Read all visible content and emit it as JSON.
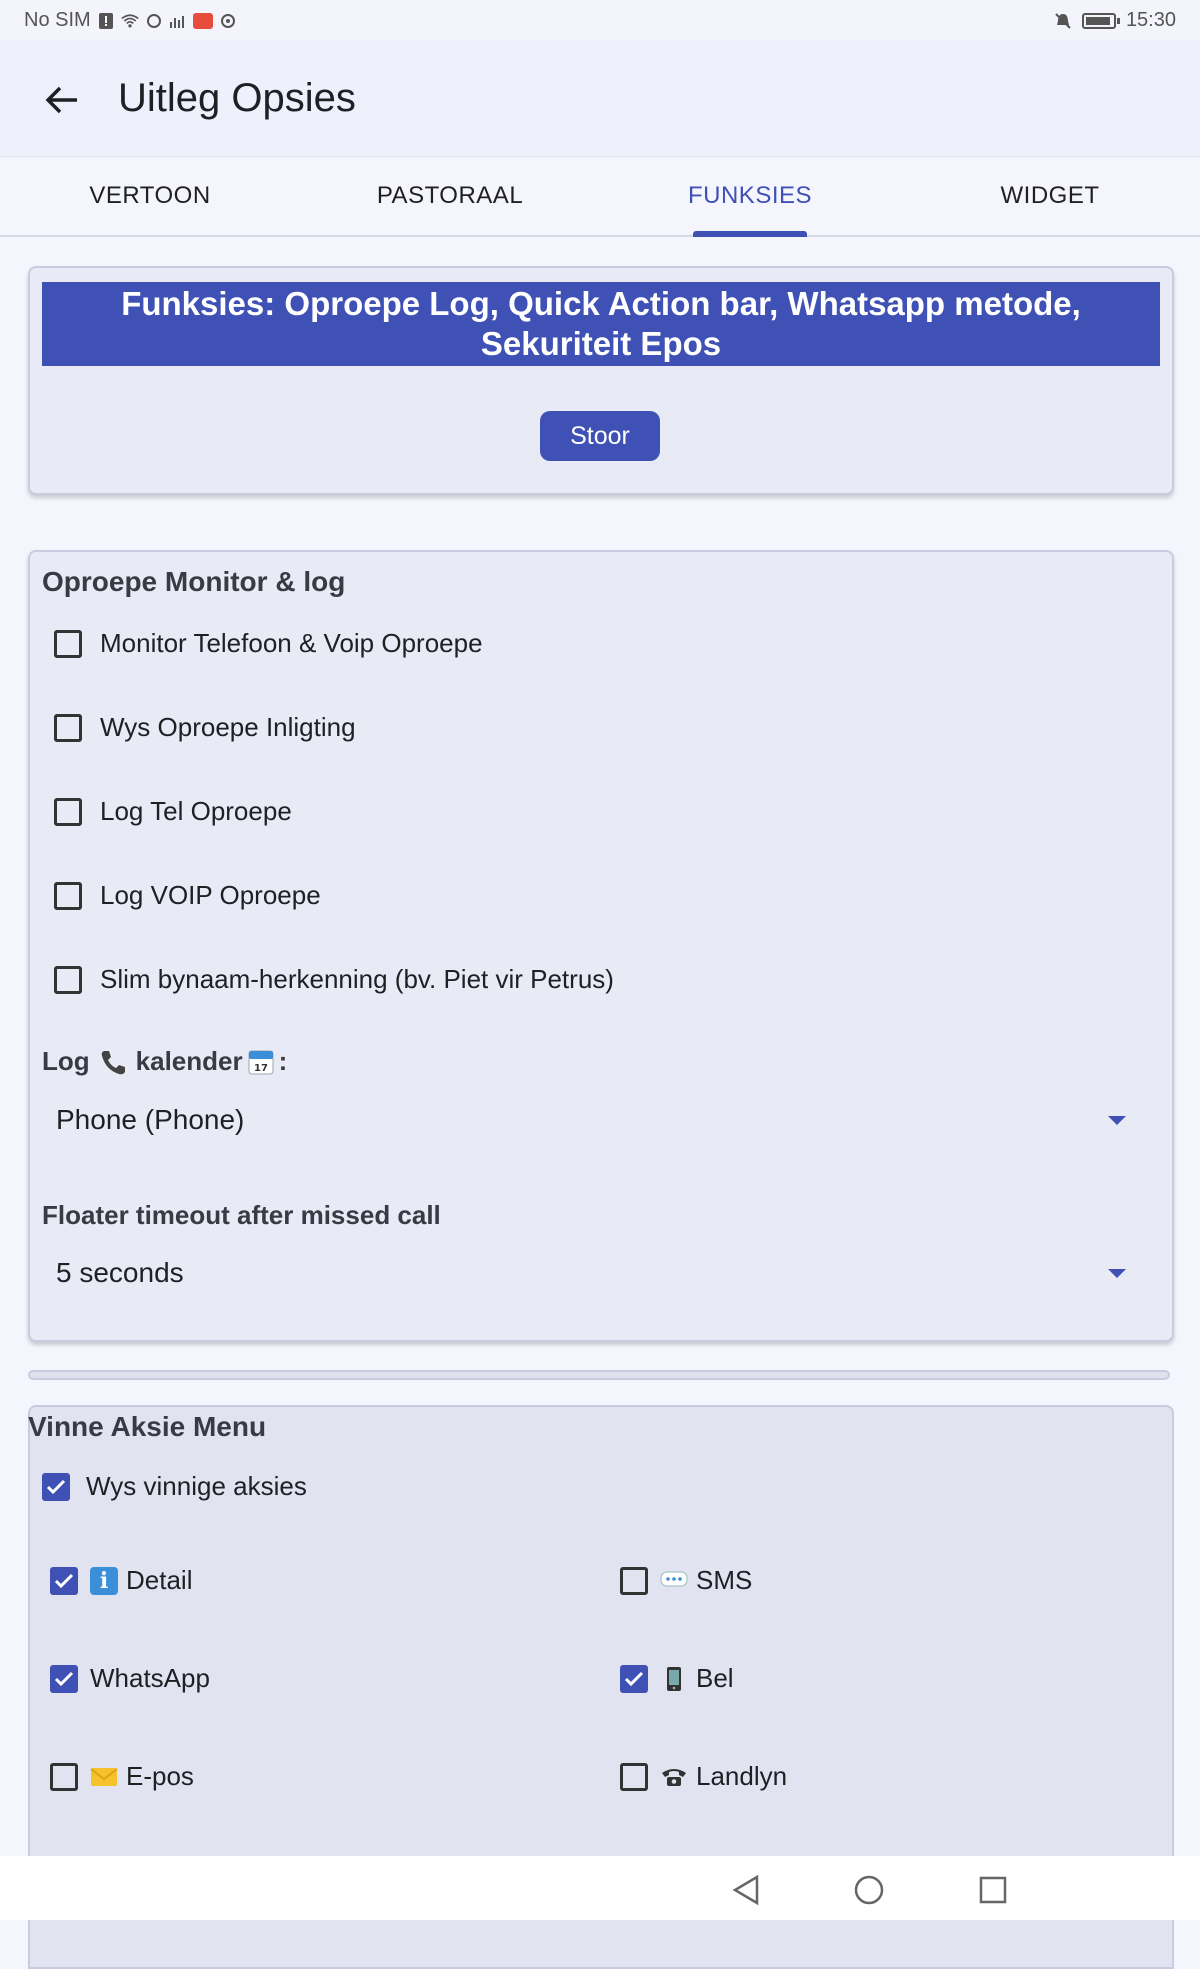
{
  "status_bar": {
    "carrier": "No SIM",
    "time": "15:30",
    "battery_level": 0.8
  },
  "app_bar": {
    "title": "Uitleg Opsies",
    "back_icon": "arrow-back-icon"
  },
  "tabs": [
    {
      "label": "VERTOON",
      "active": false
    },
    {
      "label": "PASTORAAL",
      "active": false
    },
    {
      "label": "FUNKSIES",
      "active": true
    },
    {
      "label": "WIDGET",
      "active": false
    }
  ],
  "intro_card": {
    "banner": "Funksies: Oproepe Log, Quick Action bar, Whatsapp metode, Sekuriteit Epos",
    "save_label": "Stoor"
  },
  "call_monitor": {
    "title": "Oproepe Monitor & log",
    "options": [
      {
        "label": "Monitor Telefoon & Voip Oproepe",
        "checked": false
      },
      {
        "label": "Wys Oproepe Inligting",
        "checked": false
      },
      {
        "label": "Log Tel Oproepe",
        "checked": false
      },
      {
        "label": "Log VOIP Oproepe",
        "checked": false
      },
      {
        "label": "Slim bynaam-herkenning (bv. Piet vir Petrus)",
        "checked": false
      }
    ],
    "calendar_label_prefix": "Log",
    "calendar_label_mid": "kalender",
    "calendar_label_suffix": ":",
    "calendar_value": "Phone (Phone)",
    "timeout_label": "Floater timeout after missed call",
    "timeout_value": "5 seconds"
  },
  "quick_menu": {
    "title": "Vinne Aksie Menu",
    "show_label": "Wys vinnige aksies",
    "show_checked": true,
    "actions": [
      {
        "label": "Detail",
        "icon": "info-icon",
        "checked": true
      },
      {
        "label": "SMS",
        "icon": "speech-bubble-icon",
        "checked": false
      },
      {
        "label": "WhatsApp",
        "icon": "",
        "checked": true
      },
      {
        "label": "Bel",
        "icon": "mobile-phone-icon",
        "checked": true
      },
      {
        "label": "E-pos",
        "icon": "envelope-icon",
        "checked": false
      },
      {
        "label": "Landlyn",
        "icon": "telephone-icon",
        "checked": false
      }
    ]
  },
  "colors": {
    "accent": "#3f51b5",
    "card_bg": "#e8eaf6",
    "page_bg": "#f5f6fd"
  }
}
